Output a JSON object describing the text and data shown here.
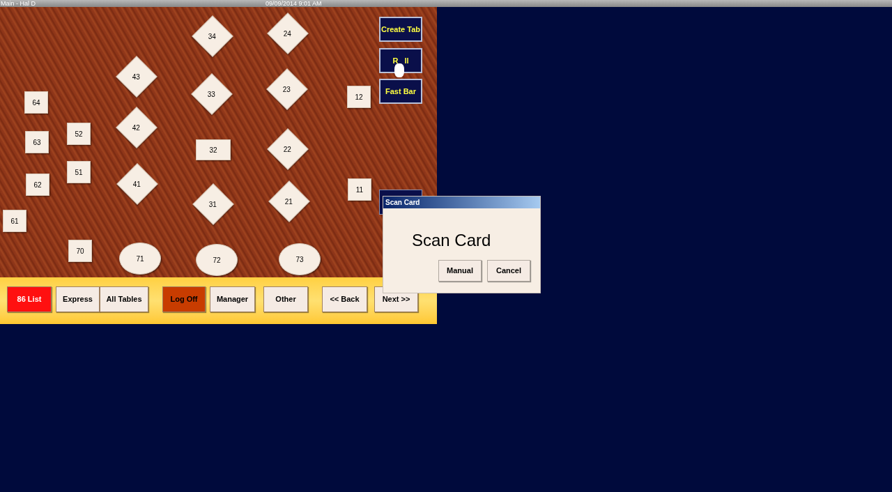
{
  "title_bar": {
    "title": "Main - Hal D",
    "datetime": "09/09/2014 9:01 AM"
  },
  "tables": [
    {
      "label": "34",
      "kind": "diamond"
    },
    {
      "label": "24",
      "kind": "diamond"
    },
    {
      "label": "43",
      "kind": "diamond"
    },
    {
      "label": "33",
      "kind": "diamond"
    },
    {
      "label": "23",
      "kind": "diamond"
    },
    {
      "label": "12",
      "kind": "square"
    },
    {
      "label": "64",
      "kind": "square"
    },
    {
      "label": "52",
      "kind": "square"
    },
    {
      "label": "42",
      "kind": "diamond"
    },
    {
      "label": "63",
      "kind": "square"
    },
    {
      "label": "32",
      "kind": "rect"
    },
    {
      "label": "22",
      "kind": "diamond"
    },
    {
      "label": "51",
      "kind": "square"
    },
    {
      "label": "41",
      "kind": "diamond"
    },
    {
      "label": "62",
      "kind": "square"
    },
    {
      "label": "11",
      "kind": "square"
    },
    {
      "label": "31",
      "kind": "diamond"
    },
    {
      "label": "21",
      "kind": "diamond"
    },
    {
      "label": "61",
      "kind": "square"
    },
    {
      "label": "70",
      "kind": "square"
    },
    {
      "label": "71",
      "kind": "oval"
    },
    {
      "label": "72",
      "kind": "oval"
    },
    {
      "label": "73",
      "kind": "oval"
    }
  ],
  "side_buttons": [
    {
      "label": "Create Tab",
      "kind": "labeled"
    },
    {
      "label": "R   ll",
      "kind": "labeled"
    },
    {
      "label": "Fast Bar",
      "kind": "labeled"
    },
    {
      "kind": "covered"
    }
  ],
  "bottom_buttons": [
    {
      "label": "86 List",
      "kind": "alert"
    },
    {
      "label": "Express",
      "kind": "plain"
    },
    {
      "label": "All Tables",
      "kind": "plain"
    },
    {
      "label": "Log Off",
      "kind": "danger"
    },
    {
      "label": "Manager",
      "kind": "plain"
    },
    {
      "label": "Other",
      "kind": "plain"
    },
    {
      "label": "<< Back",
      "kind": "plain"
    },
    {
      "label": "Next >>",
      "kind": "plain"
    }
  ],
  "dialog": {
    "title": "Scan Card",
    "message": "Scan Card",
    "buttons": [
      "Manual",
      "Cancel"
    ]
  }
}
